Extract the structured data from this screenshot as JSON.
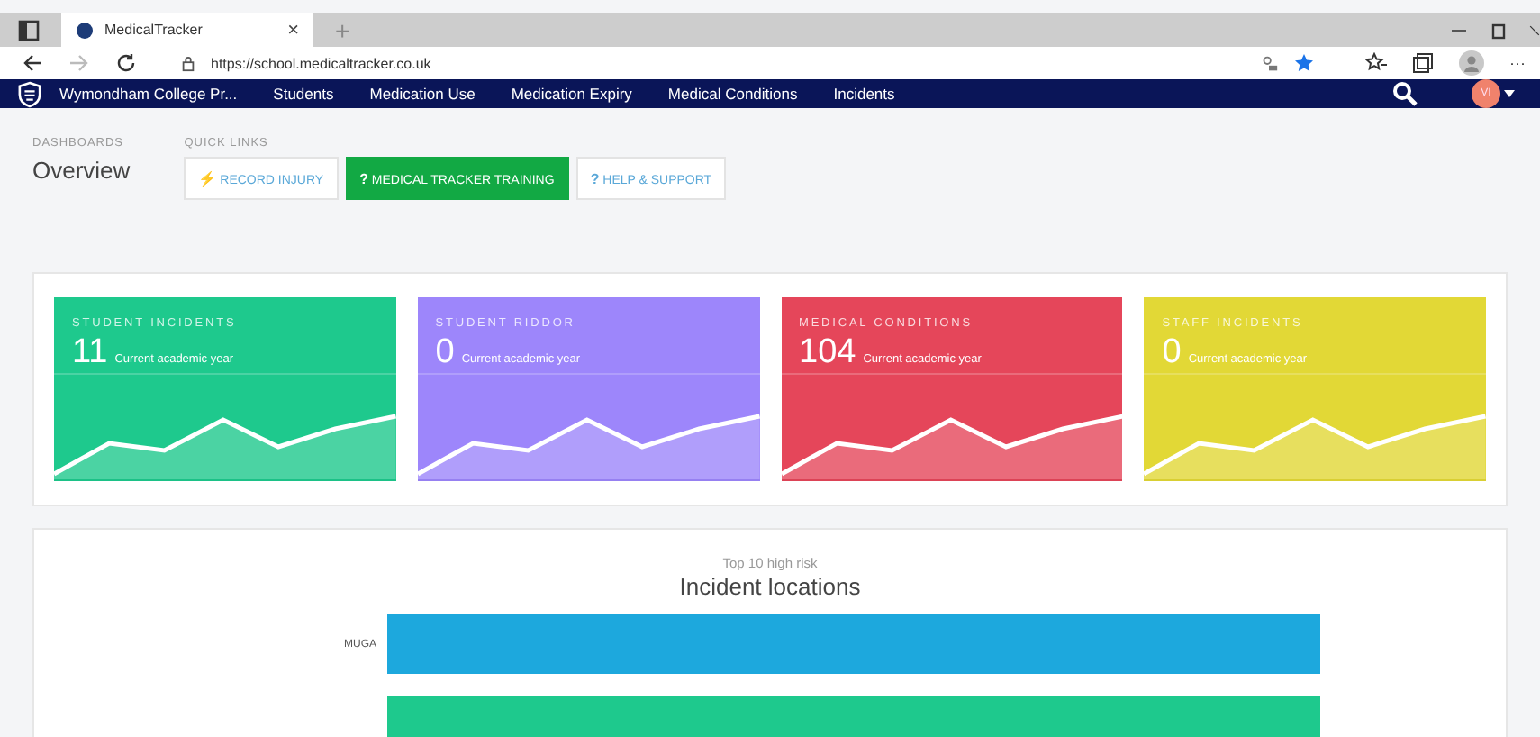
{
  "browser": {
    "tab_title": "MedicalTracker",
    "new_tab": "+",
    "close_tab": "×",
    "url": "https://school.medicaltracker.co.uk",
    "more": "···"
  },
  "navbar": {
    "brand": "Wymondham College Pr...",
    "items": [
      "Students",
      "Medication Use",
      "Medication Expiry",
      "Medical Conditions",
      "Incidents"
    ],
    "avatar": "VI"
  },
  "header": {
    "section": "DASHBOARDS",
    "title": "Overview",
    "quick_links_label": "QUICK LINKS",
    "quick_links": [
      {
        "icon": "⚡",
        "label": "RECORD INJURY",
        "kind": "outline"
      },
      {
        "icon": "?",
        "label": "MEDICAL TRACKER TRAINING",
        "kind": "solid"
      },
      {
        "icon": "?",
        "label": "HELP & SUPPORT",
        "kind": "outline"
      }
    ]
  },
  "cards": [
    {
      "title": "STUDENT INCIDENTS",
      "value": "11",
      "caption": "Current academic year",
      "color": "#1ec98d"
    },
    {
      "title": "STUDENT RIDDOR",
      "value": "0",
      "caption": "Current academic year",
      "color": "#9d86fb"
    },
    {
      "title": "MEDICAL CONDITIONS",
      "value": "104",
      "caption": "Current academic year",
      "color": "#e5465a"
    },
    {
      "title": "STAFF INCIDENTS",
      "value": "0",
      "caption": "Current academic year",
      "color": "#e2d836"
    }
  ],
  "chart": {
    "subtitle": "Top 10 high risk",
    "title": "Incident locations",
    "bars": [
      {
        "label": "MUGA",
        "color": "#1da8dd"
      },
      {
        "color": "#1ec98d"
      }
    ]
  }
}
